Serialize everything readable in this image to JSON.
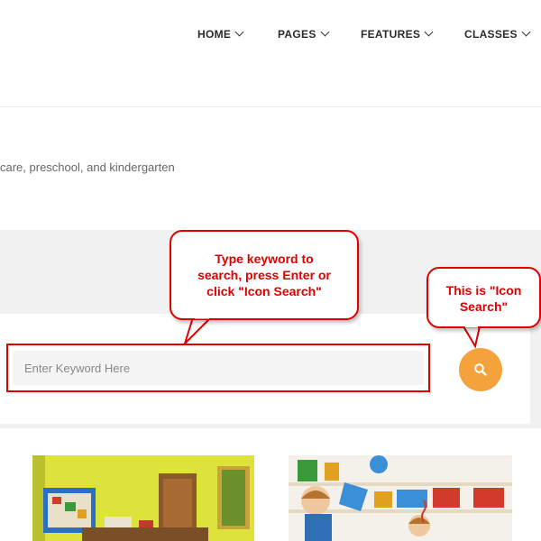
{
  "nav": {
    "items": [
      {
        "label": "HOME"
      },
      {
        "label": "PAGES"
      },
      {
        "label": "FEATURES"
      },
      {
        "label": "CLASSES"
      }
    ]
  },
  "subtitle": "care, preschool, and kindergarten",
  "search": {
    "placeholder": "Enter Keyword Here"
  },
  "callouts": {
    "input_note": [
      "Type keyword to",
      "search, press Enter or",
      "click \"Icon Search\""
    ],
    "button_note": [
      "This is \"Icon",
      "Search\""
    ]
  },
  "colors": {
    "accent": "#f4a23c",
    "annotation_red": "#e00000"
  },
  "icons": {
    "search_button": "search-icon",
    "nav_dropdown": "chevron-down-icon"
  }
}
